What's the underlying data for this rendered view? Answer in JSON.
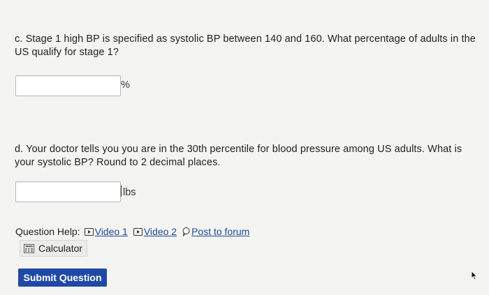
{
  "question_c": {
    "text": "c. Stage 1 high BP is specified as systolic BP between 140 and 160. What percentage of adults in the US qualify for stage 1?",
    "answer_value": "",
    "unit": "%"
  },
  "question_d": {
    "text": "d. Your doctor tells you you are in the 30th percentile for blood pressure among US adults. What is your systolic BP? Round to 2 decimal places.",
    "answer_value": "",
    "unit": "lbs"
  },
  "help": {
    "label": "Question Help:",
    "video1": "Video 1",
    "video2": "Video 2",
    "forum": "Post to forum",
    "calculator": "Calculator"
  },
  "submit_label": "Submit Question",
  "icons": {
    "video": "video-play-icon",
    "forum": "speech-bubble-icon",
    "calculator": "calculator-icon",
    "cursor": "mouse-pointer-icon"
  }
}
